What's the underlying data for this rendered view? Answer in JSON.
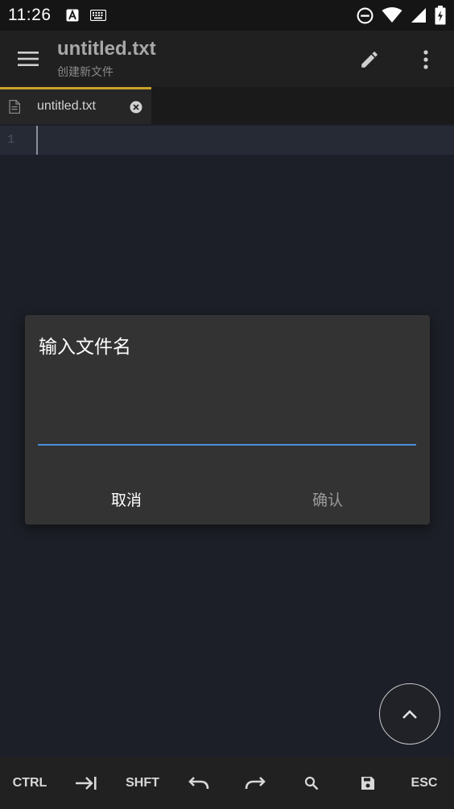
{
  "status_bar": {
    "time": "11:26",
    "left_icons": [
      "app-a-icon",
      "keyboard-icon"
    ],
    "right_icons": [
      "do-not-disturb-icon",
      "wifi-icon",
      "signal-icon",
      "battery-charging-icon"
    ]
  },
  "toolbar": {
    "title": "untitled.txt",
    "subtitle": "创建新文件",
    "icons": [
      "menu-icon",
      "pencil-icon",
      "more-vert-icon"
    ]
  },
  "tabs": [
    {
      "label": "untitled.txt",
      "active": true
    }
  ],
  "editor": {
    "line_numbers": [
      "1"
    ]
  },
  "dialog": {
    "title": "输入文件名",
    "input_value": "",
    "cancel_label": "取消",
    "confirm_label": "确认"
  },
  "fab": {
    "icon": "chevron-up-icon"
  },
  "bottom_bar": {
    "keys": [
      {
        "label": "CTRL"
      },
      {
        "label": "",
        "icon": "tab-arrow-icon"
      },
      {
        "label": "SHFT"
      },
      {
        "label": "",
        "icon": "undo-icon"
      },
      {
        "label": "",
        "icon": "redo-icon"
      },
      {
        "label": "",
        "icon": "search-icon"
      },
      {
        "label": "",
        "icon": "save-icon"
      },
      {
        "label": "ESC"
      }
    ]
  },
  "colors": {
    "background": "#1c1f27",
    "toolbar": "#202020",
    "tab_accent": "#c9a227",
    "input_underline": "#4a8fdc",
    "dialog": "#333333"
  }
}
